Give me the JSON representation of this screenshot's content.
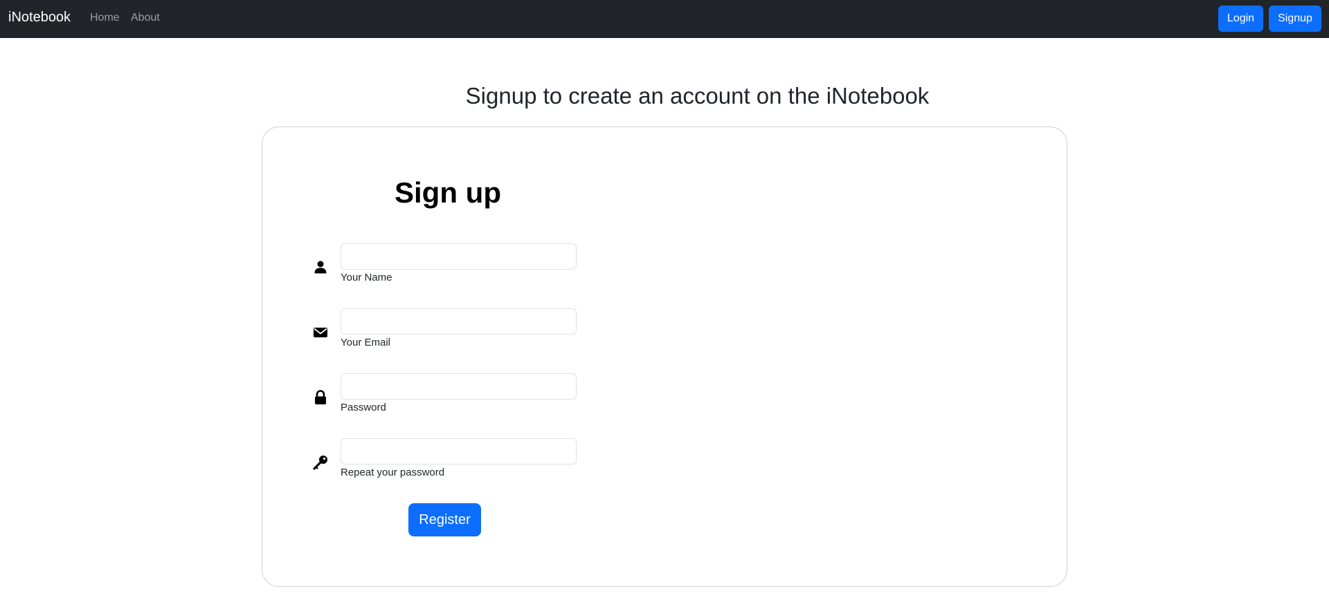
{
  "navbar": {
    "brand": "iNotebook",
    "links": [
      {
        "label": "Home"
      },
      {
        "label": "About"
      }
    ],
    "login_label": "Login",
    "signup_label": "Signup"
  },
  "page": {
    "heading": "Signup to create an account on the iNotebook"
  },
  "form": {
    "title": "Sign up",
    "fields": [
      {
        "label": "Your Name",
        "icon": "user-icon",
        "value": "",
        "placeholder": ""
      },
      {
        "label": "Your Email",
        "icon": "envelope-icon",
        "value": "",
        "placeholder": ""
      },
      {
        "label": "Password",
        "icon": "lock-icon",
        "value": "",
        "placeholder": ""
      },
      {
        "label": "Repeat your password",
        "icon": "key-icon",
        "value": "",
        "placeholder": ""
      }
    ],
    "submit_label": "Register"
  },
  "colors": {
    "navbar_bg": "#212529",
    "primary": "#0d6efd"
  }
}
